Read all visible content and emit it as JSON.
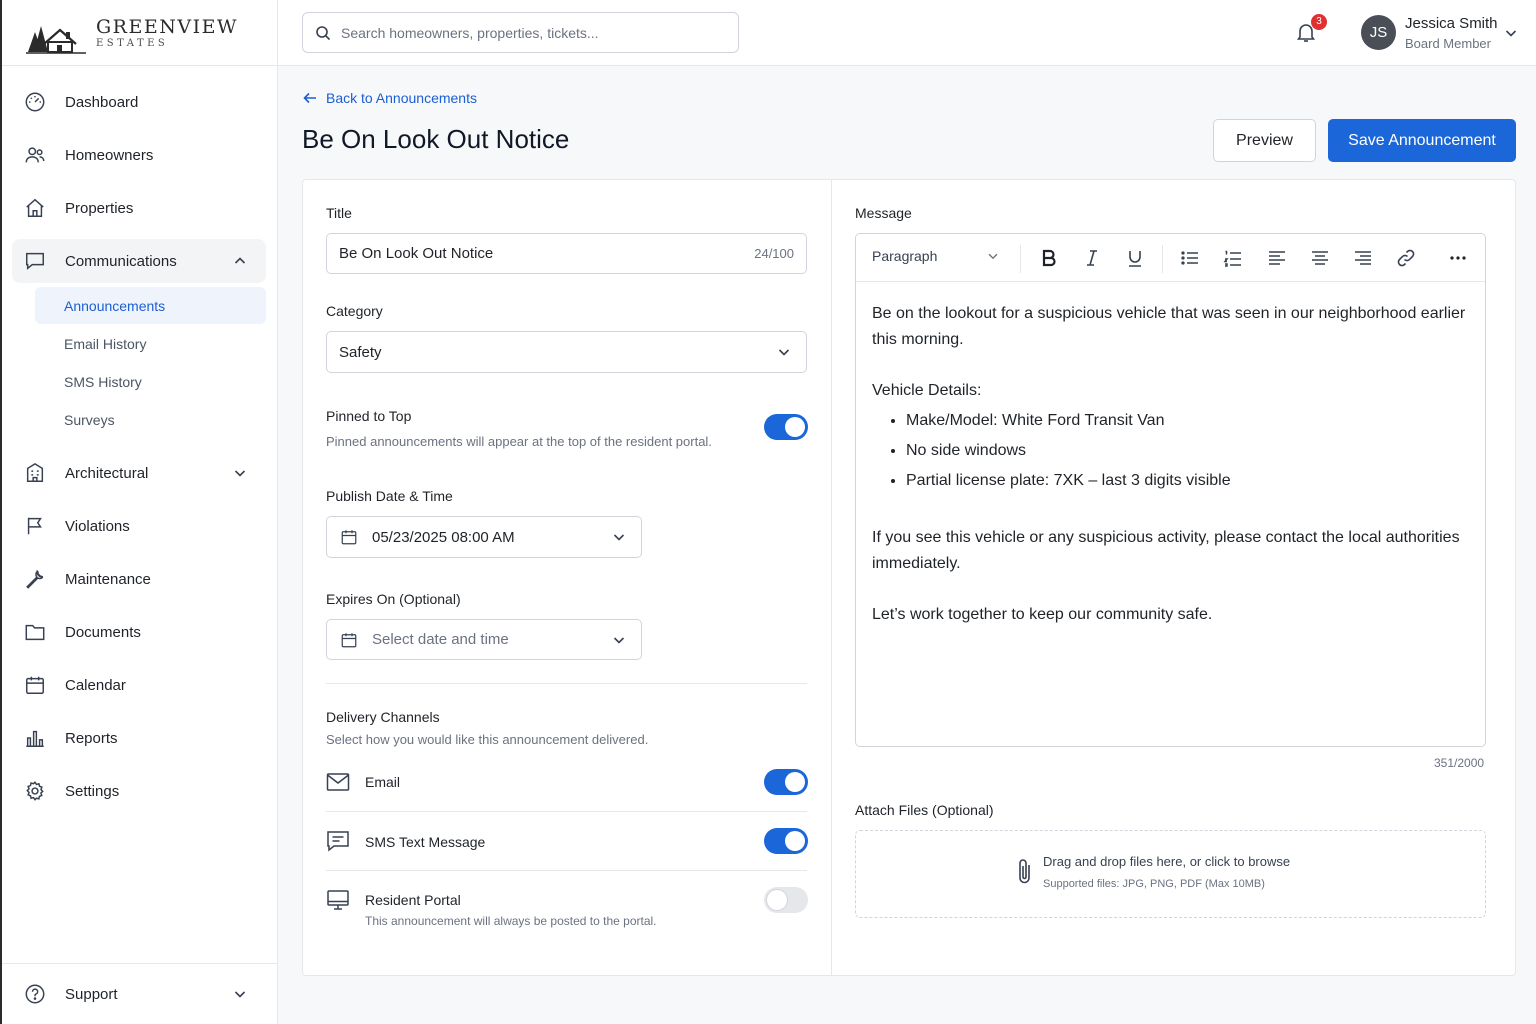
{
  "brand": {
    "name": "GREENVIEW",
    "sub": "ESTATES"
  },
  "search": {
    "placeholder": "Search homeowners, properties, tickets..."
  },
  "notifications": {
    "count": "3"
  },
  "user": {
    "initials": "JS",
    "name": "Jessica Smith",
    "role": "Board Member"
  },
  "sidebar": {
    "items": [
      {
        "label": "Dashboard",
        "icon": "dashboard-icon"
      },
      {
        "label": "Homeowners",
        "icon": "users-icon"
      },
      {
        "label": "Properties",
        "icon": "home-icon"
      },
      {
        "label": "Communications",
        "icon": "message-icon"
      },
      {
        "label": "Architectural",
        "icon": "building-icon"
      },
      {
        "label": "Violations",
        "icon": "flag-icon"
      },
      {
        "label": "Maintenance",
        "icon": "wrench-icon"
      },
      {
        "label": "Documents",
        "icon": "folder-icon"
      },
      {
        "label": "Calendar",
        "icon": "calendar-icon"
      },
      {
        "label": "Reports",
        "icon": "bar-chart-icon"
      },
      {
        "label": "Settings",
        "icon": "gear-icon"
      }
    ],
    "sub_items": [
      "Announcements",
      "Email History",
      "SMS History",
      "Surveys"
    ],
    "support": "Support"
  },
  "page": {
    "back": "Back to Announcements",
    "title": "Be On Look Out Notice",
    "preview": "Preview",
    "save": "Save Announcement"
  },
  "form": {
    "title_label": "Title",
    "title_value": "Be On Look Out Notice",
    "title_count": "24/100",
    "category_label": "Category",
    "category_value": "Safety",
    "pinned_label": "Pinned to Top",
    "pinned_desc": "Pinned announcements will appear at the top of the resident portal.",
    "pinned_on": true,
    "publish_label": "Publish Date & Time",
    "publish_value": "05/23/2025 08:00 AM",
    "expires_label": "Expires On (Optional)",
    "expires_placeholder": "Select date and time",
    "delivery_label": "Delivery Channels",
    "delivery_desc": "Select how you would like this announcement delivered.",
    "channels": [
      {
        "label": "Email",
        "icon": "mail-icon",
        "on": true
      },
      {
        "label": "SMS Text Message",
        "icon": "sms-icon",
        "on": true
      },
      {
        "label": "Resident Portal",
        "icon": "monitor-icon",
        "on": false,
        "desc": "This announcement will always be posted to the portal."
      }
    ]
  },
  "message": {
    "label": "Message",
    "format": "Paragraph",
    "intro": "Be on the lookout for a suspicious vehicle that was seen in our neighborhood earlier this morning.",
    "details_heading": "Vehicle Details:",
    "details": [
      "Make/Model: White Ford Transit Van",
      "No side windows",
      "Partial license plate: 7XK – last 3 digits visible"
    ],
    "contact": "If you see this vehicle or any suspicious activity, please contact the local authorities immediately.",
    "closing": "Let’s work together to keep our community safe.",
    "count": "351/2000"
  },
  "attach": {
    "label": "Attach Files (Optional)",
    "primary": "Drag and drop files here, or click to browse",
    "secondary": "Supported files: JPG, PNG, PDF (Max 10MB)"
  },
  "colors": {
    "accent": "#1b66d8",
    "badge": "#e03131"
  }
}
